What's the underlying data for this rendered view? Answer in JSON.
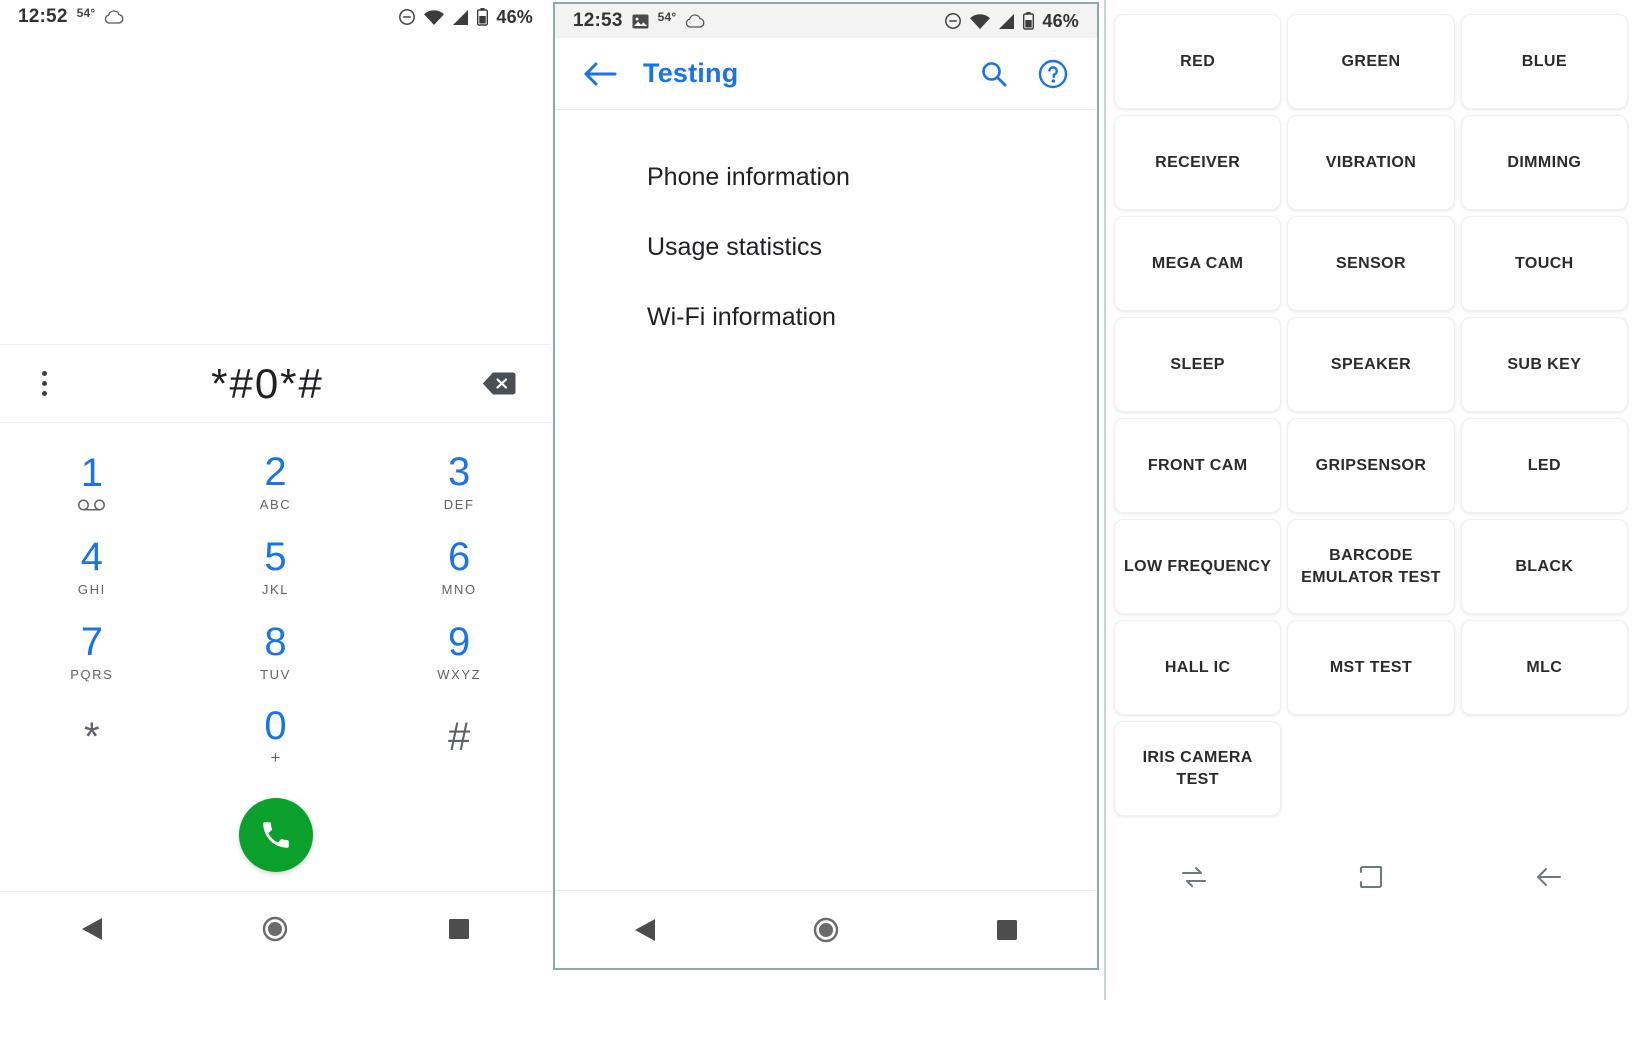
{
  "phone_dialer": {
    "status_bar": {
      "time": "12:52",
      "temperature": "54°",
      "weather_icon": "cloud-icon",
      "dnd_icon": "do-not-disturb-icon",
      "wifi_icon": "wifi-icon",
      "signal_icon": "cellular-signal-icon",
      "battery_icon": "battery-icon",
      "battery_percent": "46%"
    },
    "overflow_menu": "overflow-menu-icon",
    "dialed_number": "*#0*#",
    "backspace": "backspace-icon",
    "keypad": [
      {
        "num": "1",
        "sub": "",
        "sub_icon": "voicemail-icon",
        "gray": false
      },
      {
        "num": "2",
        "sub": "ABC",
        "gray": false
      },
      {
        "num": "3",
        "sub": "DEF",
        "gray": false
      },
      {
        "num": "4",
        "sub": "GHI",
        "gray": false
      },
      {
        "num": "5",
        "sub": "JKL",
        "gray": false
      },
      {
        "num": "6",
        "sub": "MNO",
        "gray": false
      },
      {
        "num": "7",
        "sub": "PQRS",
        "gray": false
      },
      {
        "num": "8",
        "sub": "TUV",
        "gray": false
      },
      {
        "num": "9",
        "sub": "WXYZ",
        "gray": false
      },
      {
        "num": "*",
        "sub": "",
        "gray": true
      },
      {
        "num": "0",
        "sub": "+",
        "gray": false
      },
      {
        "num": "#",
        "sub": "",
        "gray": true
      }
    ],
    "call_button": "call-icon",
    "nav": {
      "back": "back-triangle-icon",
      "home": "home-circle-icon",
      "recents": "recents-square-icon"
    },
    "accent_color": "#1a73e8",
    "call_button_color": "#0ba02c"
  },
  "phone_testing": {
    "status_bar": {
      "time": "12:53",
      "image_icon": "screenshot-icon",
      "temperature": "54°",
      "weather_icon": "cloud-icon",
      "dnd_icon": "do-not-disturb-icon",
      "wifi_icon": "wifi-icon",
      "signal_icon": "cellular-signal-icon",
      "battery_icon": "battery-icon",
      "battery_percent": "46%"
    },
    "app_bar": {
      "back_icon": "arrow-back-icon",
      "title": "Testing",
      "search_icon": "search-icon",
      "help_icon": "help-circle-icon"
    },
    "menu_items": [
      "Phone information",
      "Usage statistics",
      "Wi-Fi information"
    ],
    "nav": {
      "back": "back-triangle-icon",
      "home": "home-circle-icon",
      "recents": "recents-square-icon"
    },
    "accent_color": "#1a73e8"
  },
  "phone_test_grid": {
    "buttons": [
      "RED",
      "GREEN",
      "BLUE",
      "RECEIVER",
      "VIBRATION",
      "DIMMING",
      "MEGA CAM",
      "SENSOR",
      "TOUCH",
      "SLEEP",
      "SPEAKER",
      "SUB KEY",
      "FRONT CAM",
      "GRIPSENSOR",
      "LED",
      "LOW FREQUENCY",
      "BARCODE\nEMULATOR TEST",
      "BLACK",
      "HALL IC",
      "MST TEST",
      "MLC",
      "IRIS CAMERA\nTEST",
      "",
      ""
    ],
    "nav": {
      "recents": "recents-swap-icon",
      "home": "home-square-icon",
      "back": "back-arrow-icon"
    }
  }
}
